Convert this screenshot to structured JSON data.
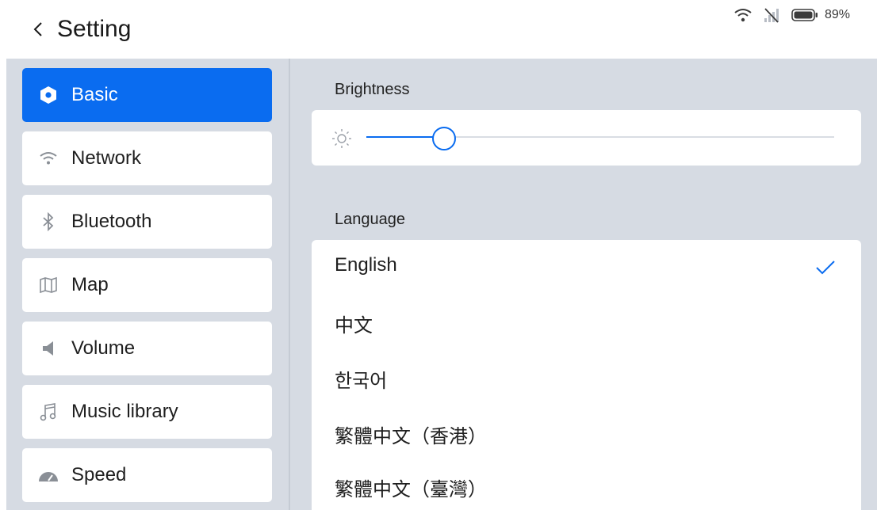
{
  "header": {
    "title": "Setting",
    "back_icon": "chevron-left-icon"
  },
  "status_bar": {
    "wifi_icon": "wifi-icon",
    "signal_icon": "no-signal-icon",
    "battery_icon": "battery-icon",
    "battery_percent": "89%"
  },
  "sidebar": {
    "items": [
      {
        "label": "Basic",
        "icon": "hexagon-icon",
        "active": true
      },
      {
        "label": "Network",
        "icon": "wifi-icon",
        "active": false
      },
      {
        "label": "Bluetooth",
        "icon": "bluetooth-icon",
        "active": false
      },
      {
        "label": "Map",
        "icon": "map-icon",
        "active": false
      },
      {
        "label": "Volume",
        "icon": "speaker-icon",
        "active": false
      },
      {
        "label": "Music library",
        "icon": "music-note-icon",
        "active": false
      },
      {
        "label": "Speed",
        "icon": "speedometer-icon",
        "active": false
      }
    ]
  },
  "brightness": {
    "label": "Brightness",
    "level_fraction": 0.165,
    "icon": "sun-icon"
  },
  "language": {
    "label": "Language",
    "options": [
      {
        "label": "English",
        "selected": true
      },
      {
        "label": "中文",
        "selected": false
      },
      {
        "label": "한국어",
        "selected": false
      },
      {
        "label": "繁體中文（香港）",
        "selected": false
      },
      {
        "label": "繁體中文（臺灣）",
        "selected": false
      }
    ]
  },
  "colors": {
    "accent": "#0a6cf0",
    "panel_bg": "#d6dbe3",
    "card_bg": "#ffffff"
  }
}
